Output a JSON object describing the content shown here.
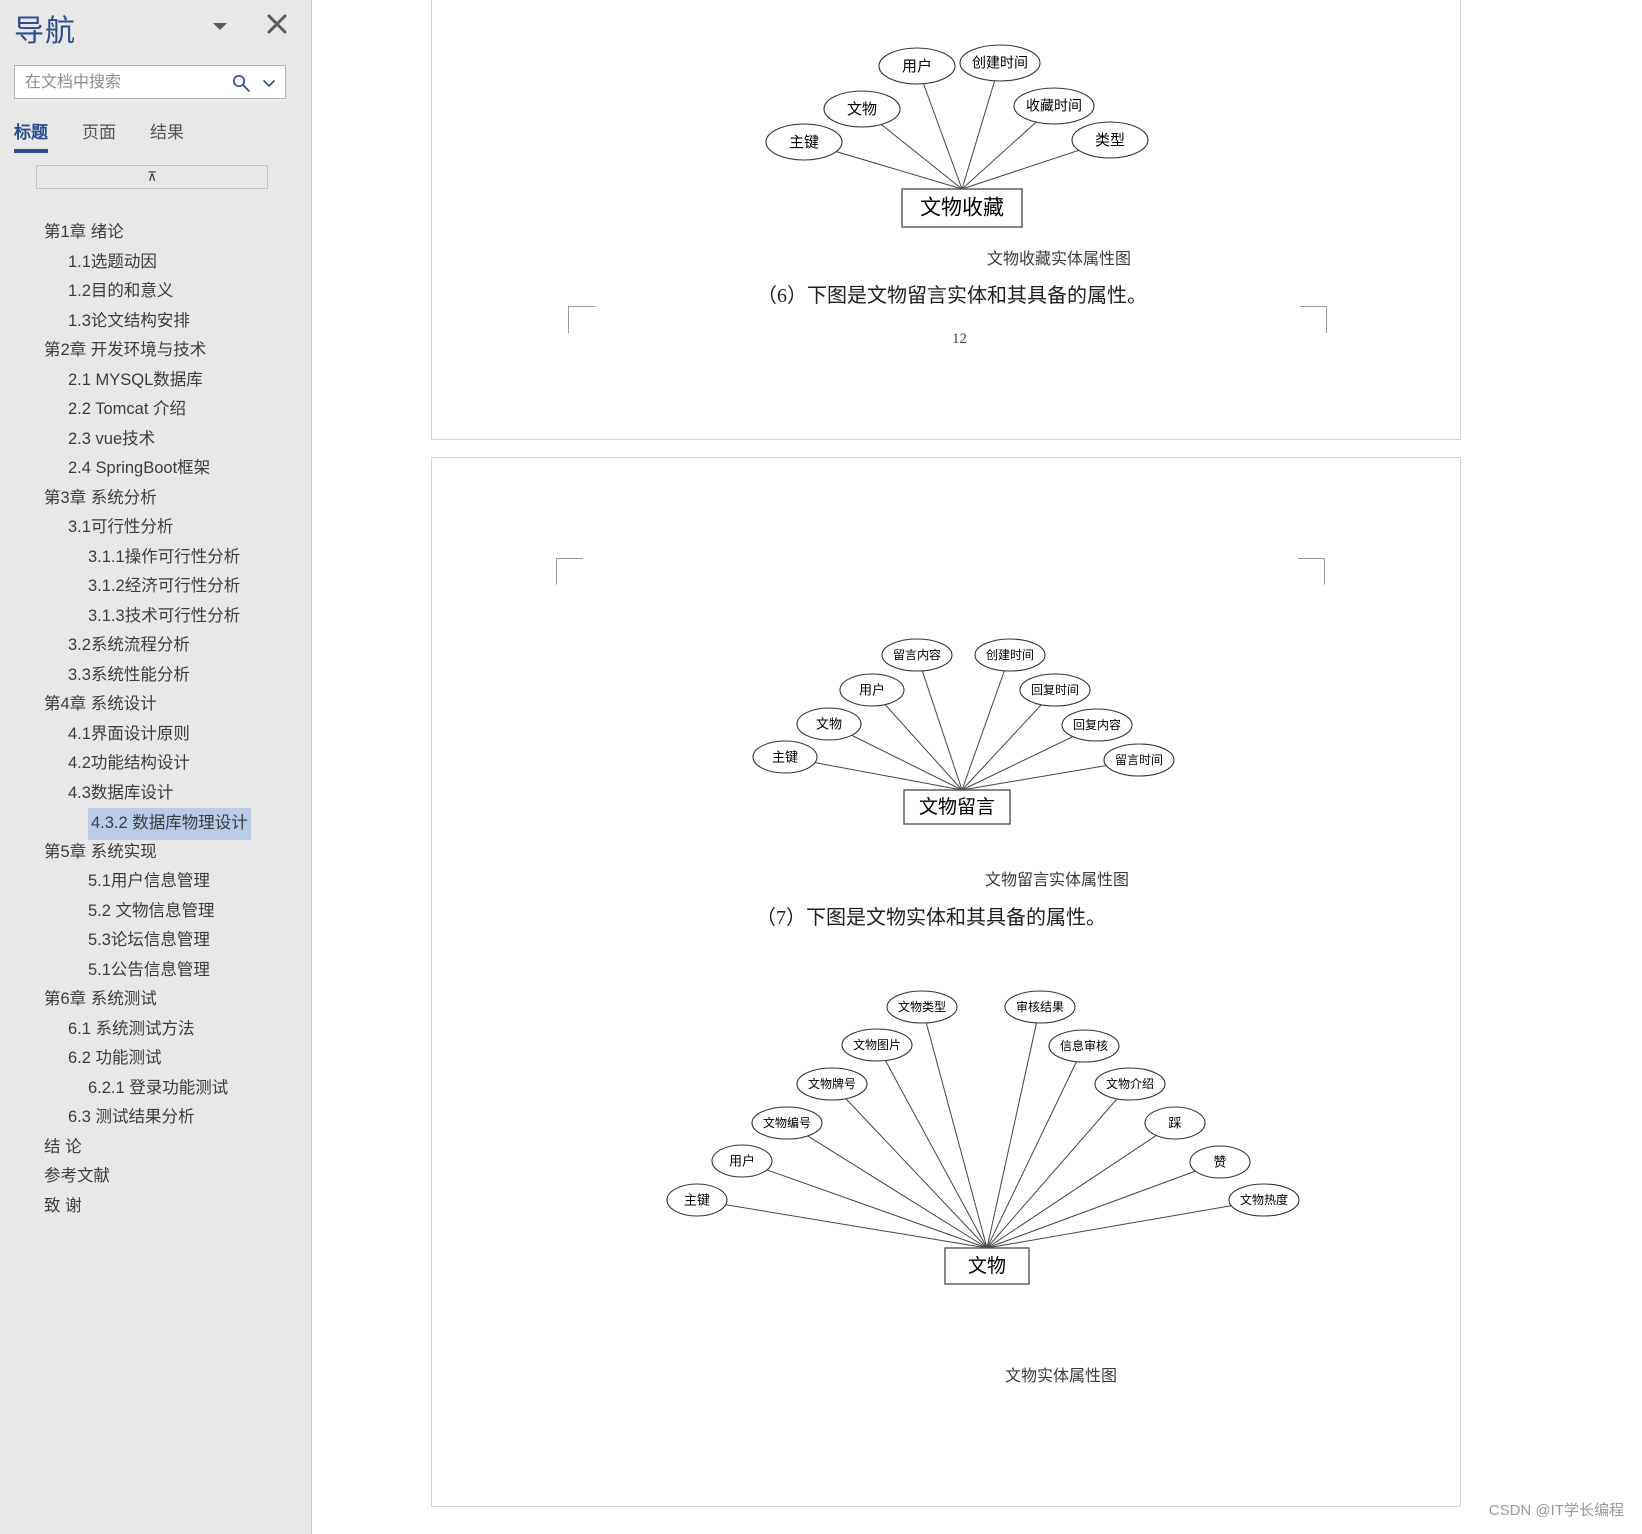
{
  "nav": {
    "title": "导航",
    "dropdown_icon": "chevron-down-icon",
    "close_icon": "close-icon",
    "search": {
      "placeholder": "在文档中搜索",
      "value": "",
      "search_icon": "search-icon",
      "chevron_icon": "chevron-down-icon"
    },
    "tabs": [
      {
        "label": "标题",
        "active": true
      },
      {
        "label": "页面",
        "active": false
      },
      {
        "label": "结果",
        "active": false
      }
    ],
    "scroll_top_glyph": "⊼",
    "toc": [
      {
        "label": "第1章 绪论",
        "level": 1,
        "caret": true,
        "selected": false
      },
      {
        "label": "1.1选题动因",
        "level": 2,
        "caret": false,
        "selected": false
      },
      {
        "label": "1.2目的和意义",
        "level": 2,
        "caret": false,
        "selected": false
      },
      {
        "label": "1.3论文结构安排",
        "level": 2,
        "caret": false,
        "selected": false
      },
      {
        "label": "第2章 开发环境与技术",
        "level": 1,
        "caret": true,
        "selected": false
      },
      {
        "label": "2.1 MYSQL数据库",
        "level": 2,
        "caret": false,
        "selected": false
      },
      {
        "label": "2.2 Tomcat 介绍",
        "level": 2,
        "caret": false,
        "selected": false
      },
      {
        "label": "2.3 vue技术",
        "level": 2,
        "caret": false,
        "selected": false
      },
      {
        "label": "2.4 SpringBoot框架",
        "level": 2,
        "caret": false,
        "selected": false
      },
      {
        "label": "第3章 系统分析",
        "level": 1,
        "caret": true,
        "selected": false
      },
      {
        "label": "3.1可行性分析",
        "level": 2,
        "caret": true,
        "selected": false
      },
      {
        "label": "3.1.1操作可行性分析",
        "level": 3,
        "caret": false,
        "selected": false
      },
      {
        "label": "3.1.2经济可行性分析",
        "level": 3,
        "caret": false,
        "selected": false
      },
      {
        "label": "3.1.3技术可行性分析",
        "level": 3,
        "caret": false,
        "selected": false
      },
      {
        "label": "3.2系统流程分析",
        "level": 2,
        "caret": false,
        "selected": false
      },
      {
        "label": "3.3系统性能分析",
        "level": 2,
        "caret": false,
        "selected": false
      },
      {
        "label": "第4章 系统设计",
        "level": 1,
        "caret": true,
        "selected": false
      },
      {
        "label": "4.1界面设计原则",
        "level": 2,
        "caret": false,
        "selected": false
      },
      {
        "label": "4.2功能结构设计",
        "level": 2,
        "caret": false,
        "selected": false
      },
      {
        "label": "4.3数据库设计",
        "level": 2,
        "caret": true,
        "selected": false
      },
      {
        "label": "4.3.2 数据库物理设计",
        "level": 3,
        "caret": false,
        "selected": true
      },
      {
        "label": "第5章 系统实现",
        "level": 1,
        "caret": true,
        "selected": false
      },
      {
        "label": "5.1用户信息管理",
        "level": 3,
        "caret": false,
        "selected": false
      },
      {
        "label": "5.2 文物信息管理",
        "level": 3,
        "caret": false,
        "selected": false
      },
      {
        "label": "5.3论坛信息管理",
        "level": 3,
        "caret": false,
        "selected": false
      },
      {
        "label": "5.1公告信息管理",
        "level": 3,
        "caret": false,
        "selected": false
      },
      {
        "label": "第6章 系统测试",
        "level": 1,
        "caret": true,
        "selected": false
      },
      {
        "label": "6.1 系统测试方法",
        "level": 2,
        "caret": false,
        "selected": false
      },
      {
        "label": "6.2 功能测试",
        "level": 2,
        "caret": true,
        "selected": false
      },
      {
        "label": "6.2.1 登录功能测试",
        "level": 3,
        "caret": false,
        "selected": false
      },
      {
        "label": "6.3 测试结果分析",
        "level": 2,
        "caret": false,
        "selected": false
      },
      {
        "label": "结  论",
        "level": 1,
        "caret": false,
        "selected": false
      },
      {
        "label": "参考文献",
        "level": 1,
        "caret": false,
        "selected": false
      },
      {
        "label": "致  谢",
        "level": 1,
        "caret": false,
        "selected": false
      }
    ]
  },
  "document": {
    "page_number": "12",
    "paragraphs": {
      "p6": "（6）下图是文物留言实体和其具备的属性。",
      "p7": "（7）下图是文物实体和其具备的属性。"
    },
    "captions": {
      "fig1": "文物收藏实体属性图",
      "fig2": "文物留言实体属性图",
      "fig3": "文物实体属性图"
    }
  },
  "watermark": "CSDN @IT学长编程",
  "chart_data": [
    {
      "type": "diagram",
      "diagram_kind": "er-entity-attribute",
      "title": "文物收藏实体属性图",
      "entity": "文物收藏",
      "attributes": [
        "主键",
        "文物",
        "用户",
        "创建时间",
        "收藏时间",
        "类型"
      ]
    },
    {
      "type": "diagram",
      "diagram_kind": "er-entity-attribute",
      "title": "文物留言实体属性图",
      "entity": "文物留言",
      "attributes": [
        "主键",
        "文物",
        "用户",
        "留言内容",
        "创建时间",
        "回复时间",
        "回复内容",
        "留言时间"
      ]
    },
    {
      "type": "diagram",
      "diagram_kind": "er-entity-attribute",
      "title": "文物实体属性图",
      "entity": "文物",
      "attributes": [
        "主键",
        "用户",
        "文物编号",
        "文物牌号",
        "文物图片",
        "文物类型",
        "审核结果",
        "信息审核",
        "文物介绍",
        "踩",
        "赞",
        "文物热度"
      ]
    }
  ]
}
